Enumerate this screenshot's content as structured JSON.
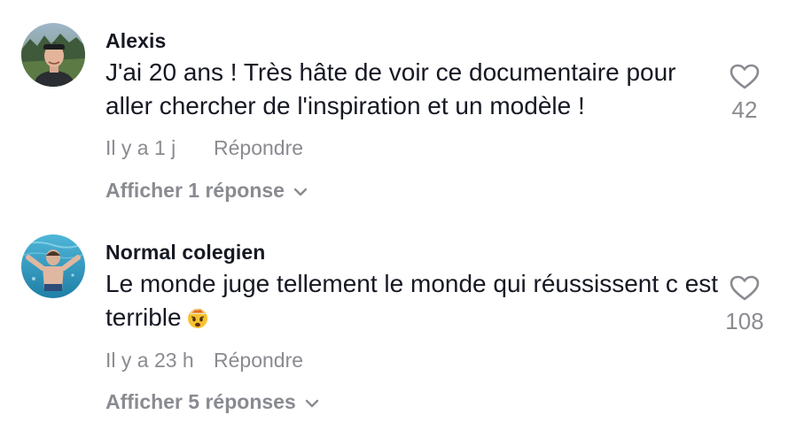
{
  "comments": [
    {
      "username": "Alexis",
      "text": "J'ai 20 ans ! Très hâte de voir ce documentaire pour aller chercher de l'inspiration et un modèle !",
      "emoji": "",
      "time": "Il y a 1 j",
      "reply_label": "Répondre",
      "view_replies": "Afficher 1 réponse",
      "likes": "42",
      "avatar_icon": "avatar-photo-man-cap-outdoors"
    },
    {
      "username": "Normal colegien",
      "text": "Le monde juge tellement le monde qui réussissent c est terrible",
      "emoji": "🤯",
      "time": "Il y a 23 h",
      "reply_label": "Répondre",
      "view_replies": "Afficher 5 réponses",
      "likes": "108",
      "avatar_icon": "avatar-photo-underwater-swimmer"
    }
  ],
  "colors": {
    "text_primary": "#161823",
    "text_secondary": "#8a8b91"
  }
}
